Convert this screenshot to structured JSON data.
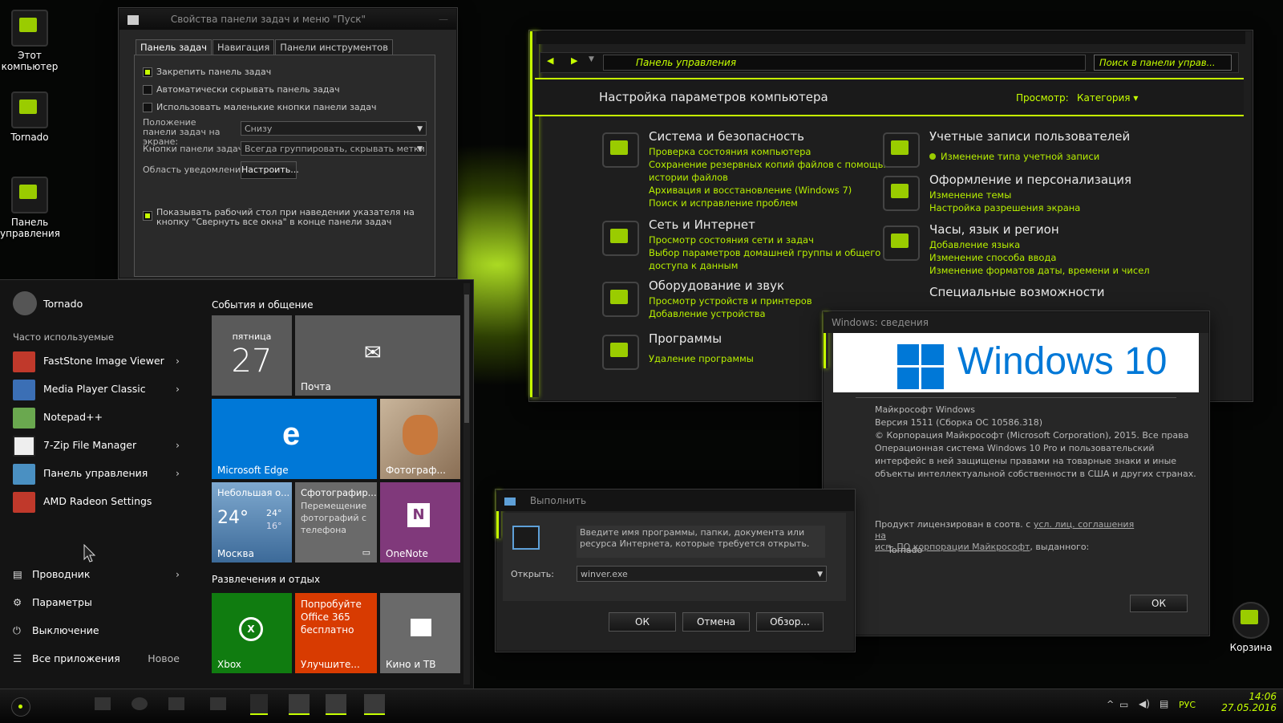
{
  "desktop": {
    "icons": [
      {
        "label": "Этот компьютер"
      },
      {
        "label": "Tornado"
      },
      {
        "label": "Панель управления"
      },
      {
        "label": "Корзина"
      }
    ]
  },
  "taskbar_props": {
    "title": "Свойства панели задач и меню \"Пуск\"",
    "tabs": [
      "Панель задач",
      "Навигация",
      "Панели инструментов"
    ],
    "checkboxes": [
      {
        "label": "Закрепить панель задач",
        "checked": true
      },
      {
        "label": "Автоматически скрывать панель задач",
        "checked": false
      },
      {
        "label": "Использовать маленькие кнопки панели задач",
        "checked": false
      }
    ],
    "position_label": "Положение панели задач на экране:",
    "position_value": "Снизу",
    "buttons_label": "Кнопки панели задач:",
    "buttons_value": "Всегда группировать, скрывать метки",
    "notif_label": "Область уведомлений:",
    "notif_button": "Настроить...",
    "peek_label": "Показывать рабочий стол при наведении указателя на кнопку \"Свернуть все окна\" в конце панели задач"
  },
  "start_menu": {
    "user": "Tornado",
    "frequent_header": "Часто используемые",
    "apps": [
      {
        "label": "FastStone Image Viewer",
        "color": "#c0392b",
        "chevron": true
      },
      {
        "label": "Media Player Classic",
        "color": "#3b6fb5",
        "chevron": true
      },
      {
        "label": "Notepad++",
        "color": "#6aa84f",
        "chevron": false
      },
      {
        "label": "7-Zip File Manager",
        "color": "#222222",
        "chevron": true
      },
      {
        "label": "Панель управления",
        "color": "#4a90c2",
        "chevron": true
      },
      {
        "label": "AMD Radeon Settings",
        "color": "#c0392b",
        "chevron": false
      }
    ],
    "bottom": [
      {
        "label": "Проводник",
        "icon": "folder-icon"
      },
      {
        "label": "Параметры",
        "icon": "gear-icon"
      },
      {
        "label": "Выключение",
        "icon": "power-icon"
      },
      {
        "label": "Все приложения",
        "icon": "list-icon",
        "extra": "Новое"
      }
    ],
    "group1": "События и общение",
    "group2": "Развлечения и отдых",
    "tiles": {
      "calendar_day": "пятница",
      "calendar_date": "27",
      "mail": "Почта",
      "edge": "Microsoft Edge",
      "photos": "Фотограф...",
      "weather_title": "Небольшая о...",
      "weather_temp": "24°",
      "weather_hi": "24°",
      "weather_lo": "16°",
      "weather_city": "Москва",
      "phone_title": "Сфотографир...",
      "phone_desc": "Перемещение фотографий с телефона на...",
      "onenote": "OneNote",
      "xbox": "Xbox",
      "office_line1": "Попробуйте",
      "office_line2": "Office 365",
      "office_line3": "бесплатно",
      "office_bottom": "Улучшите...",
      "movies": "Кино и ТВ"
    }
  },
  "control_panel": {
    "address": "Панель управления",
    "search_placeholder": "Поиск в панели управ...",
    "header": "Настройка параметров компьютера",
    "view_label": "Просмотр:",
    "view_value": "Категория ▾",
    "categories_left": [
      {
        "title": "Система и безопасность",
        "links": [
          "Проверка состояния компьютера",
          "Сохранение резервных копий файлов с помощью",
          "истории файлов",
          "Архивация и восстановление (Windows 7)",
          "Поиск и исправление проблем"
        ]
      },
      {
        "title": "Сеть и Интернет",
        "links": [
          "Просмотр состояния сети и задач",
          "Выбор параметров домашней группы и общего",
          "доступа к данным"
        ]
      },
      {
        "title": "Оборудование и звук",
        "links": [
          "Просмотр устройств и принтеров",
          "Добавление устройства"
        ]
      },
      {
        "title": "Программы",
        "links": [
          "Удаление программы"
        ]
      }
    ],
    "categories_right": [
      {
        "title": "Учетные записи пользователей",
        "links": [
          "Изменение типа учетной записи"
        ]
      },
      {
        "title": "Оформление и персонализация",
        "links": [
          "Изменение темы",
          "Настройка разрешения экрана"
        ]
      },
      {
        "title": "Часы, язык и регион",
        "links": [
          "Добавление языка",
          "Изменение способа ввода",
          "Изменение форматов даты, времени и чисел"
        ]
      },
      {
        "title": "Специальные возможности",
        "links": []
      }
    ]
  },
  "winver": {
    "title": "Windows: сведения",
    "logo_text": "Windows 10",
    "lines": [
      "Майкрософт Windows",
      "Версия 1511 (Сборка ОС 10586.318)",
      "© Корпорация Майкрософт (Microsoft Corporation), 2015. Все права",
      "Операционная система Windows 10 Pro и пользовательский",
      "интерфейс в ней защищены правами на товарные знаки и иные",
      "объекты интеллектуальной собственности в США и других странах."
    ],
    "license_prefix": "Продукт лицензирован в соотв. с",
    "license_link1": "усл. лиц. соглашения на",
    "license_link2": "исп. ПО корпорации Майкрософт",
    "license_suffix": ", выданного:",
    "owner": "Tornado",
    "ok": "ОК"
  },
  "run_dialog": {
    "title": "Выполнить",
    "description": "Введите имя программы, папки, документа или ресурса Интернета, которые требуется открыть.",
    "open_label": "Открыть:",
    "value": "winver.exe",
    "ok": "ОК",
    "cancel": "Отмена",
    "browse": "Обзор..."
  },
  "tray": {
    "lang": "РУС",
    "time": "14:06",
    "date": "27.05.2016"
  },
  "colors": {
    "accent": "#c6ff00",
    "edge_tile": "#0078d7",
    "onenote_tile": "#80397b",
    "xbox_tile": "#107c10",
    "office_tile": "#d83b01"
  }
}
